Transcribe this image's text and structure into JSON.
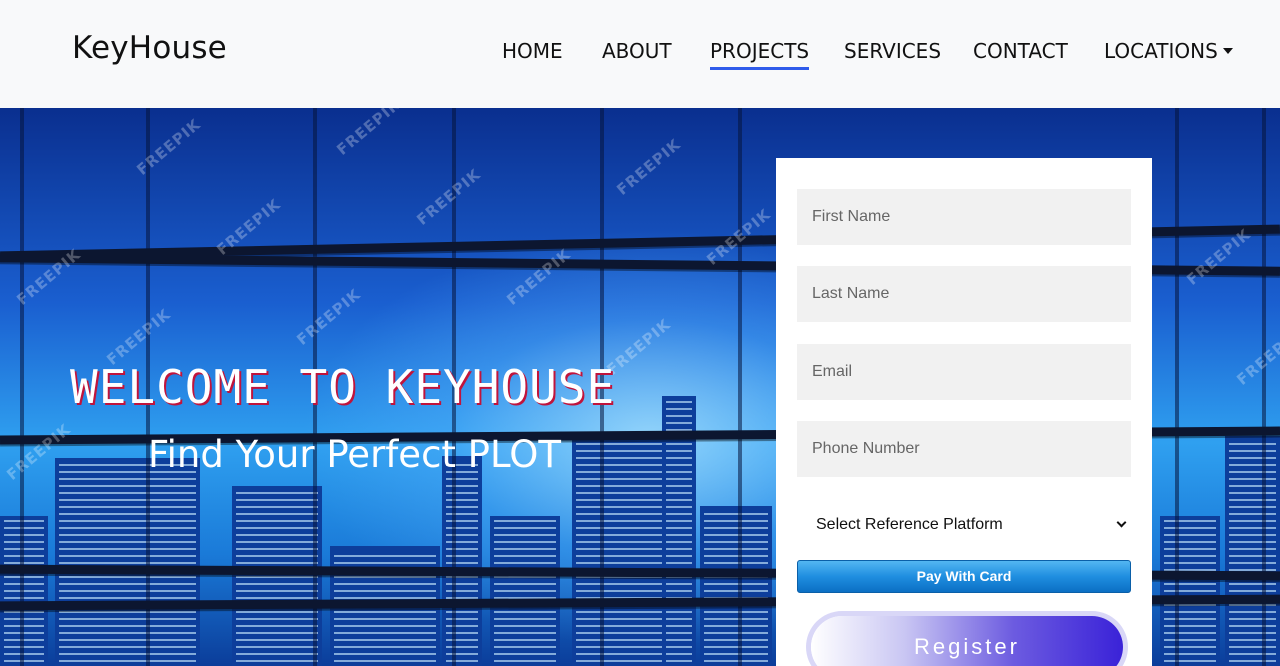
{
  "brand": "KeyHouse",
  "nav": {
    "home": "HOME",
    "about": "ABOUT",
    "projects": "PROJECTS",
    "services": "SERVICES",
    "contact": "CONTACT",
    "locations": "LOCATIONS",
    "active": "PROJECTS"
  },
  "hero": {
    "title": "WELCOME TO KEYHOUSE",
    "subtitle": "Find Your Perfect PLOT",
    "watermark": "FREEPIK"
  },
  "form": {
    "first_name_placeholder": "First Name",
    "last_name_placeholder": "Last Name",
    "email_placeholder": "Email",
    "phone_placeholder": "Phone Number",
    "reference_select": "Select Reference Platform",
    "pay_button": "Pay With Card",
    "register_button": "Register"
  },
  "colors": {
    "nav_active_underline": "#2f5bea",
    "pay_button": "#1f8ee0",
    "register_button": "#3a22d8"
  }
}
